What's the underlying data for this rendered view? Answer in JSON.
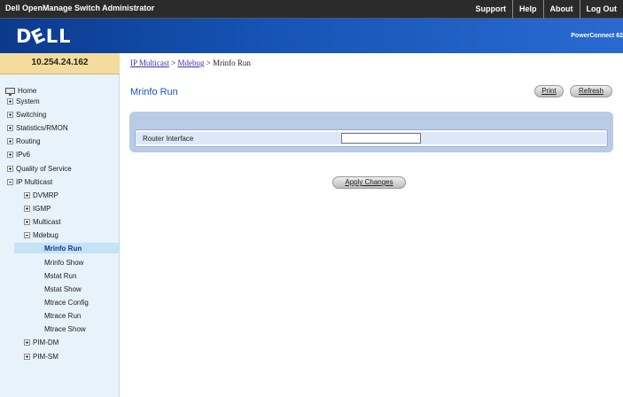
{
  "header": {
    "app_title": "Dell OpenManage Switch Administrator",
    "links": [
      "Support",
      "Help",
      "About",
      "Log Out"
    ]
  },
  "brand": {
    "logo_text": "DELL",
    "product": "PowerConnect 62"
  },
  "sidebar": {
    "ip": "10.254.24.162",
    "items": [
      {
        "label": "Home"
      },
      {
        "label": "System"
      },
      {
        "label": "Switching"
      },
      {
        "label": "Statistics/RMON"
      },
      {
        "label": "Routing"
      },
      {
        "label": "IPv6"
      },
      {
        "label": "Quality of Service"
      },
      {
        "label": "IP Multicast"
      },
      {
        "label": "DVMRP"
      },
      {
        "label": "IGMP"
      },
      {
        "label": "Multicast"
      },
      {
        "label": "Mdebug"
      },
      {
        "label": "Mrinfo Run"
      },
      {
        "label": "Mrinfo Show"
      },
      {
        "label": "Mstat Run"
      },
      {
        "label": "Mstat Show"
      },
      {
        "label": "Mtrace Config"
      },
      {
        "label": "Mtrace Run"
      },
      {
        "label": "Mtrace Show"
      },
      {
        "label": "PIM-DM"
      },
      {
        "label": "PIM-SM"
      }
    ]
  },
  "breadcrumb": {
    "items": [
      "IP Multicast",
      "Mdebug"
    ],
    "separator": ">",
    "current": "Mrinfo Run"
  },
  "main": {
    "title": "Mrinfo Run",
    "print_label": "Print",
    "refresh_label": "Refresh",
    "router_interface_label": "Router Interface",
    "router_interface_value": "",
    "apply_label": "Apply Changes"
  },
  "colors": {
    "top_bar": "#2b2b2b",
    "brand_bar": "#1552b3",
    "ip_box": "#f3dc9c",
    "sidebar": "#e8f2fa",
    "panel": "#b9cbe6",
    "title": "#1557b7",
    "link": "#3a2fa8"
  }
}
